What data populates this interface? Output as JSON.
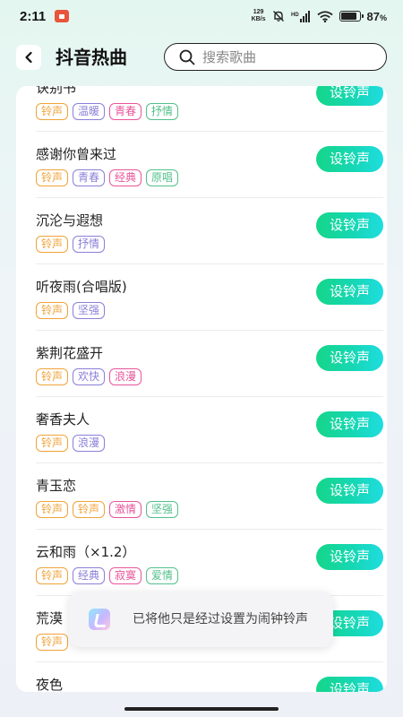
{
  "status_bar": {
    "time": "2:11",
    "net_speed_top": "129",
    "net_speed_bottom": "KB/s",
    "hd_label": "HD",
    "battery_percent": "87",
    "battery_suffix": "%",
    "battery_level": 0.87
  },
  "header": {
    "title": "抖音热曲",
    "search_placeholder": "搜索歌曲"
  },
  "tag_colors": {
    "铃声": "#f0a338",
    "温暖": "#8b7fd8",
    "青春": "#e8559a",
    "抒情": "#52c08a",
    "经典": "#e8559a",
    "原唱": "#52c08a",
    "坚强": "#8b7fd8",
    "欢快": "#8b7fd8",
    "浪漫": "#e8559a",
    "激情": "#e8559a",
    "寂寞": "#e8559a",
    "爱情": "#52c08a"
  },
  "set_button_label": "设铃声",
  "songs": [
    {
      "title": "诀别书",
      "tags": [
        {
          "label": "铃声",
          "color": "#f0a338"
        },
        {
          "label": "温暖",
          "color": "#8b7fd8"
        },
        {
          "label": "青春",
          "color": "#e8559a"
        },
        {
          "label": "抒情",
          "color": "#52c08a"
        }
      ]
    },
    {
      "title": "感谢你曾来过",
      "tags": [
        {
          "label": "铃声",
          "color": "#f0a338"
        },
        {
          "label": "青春",
          "color": "#8b7fd8"
        },
        {
          "label": "经典",
          "color": "#e8559a"
        },
        {
          "label": "原唱",
          "color": "#52c08a"
        }
      ]
    },
    {
      "title": "沉沦与遐想",
      "tags": [
        {
          "label": "铃声",
          "color": "#f0a338"
        },
        {
          "label": "抒情",
          "color": "#8b7fd8"
        }
      ]
    },
    {
      "title": "听夜雨(合唱版)",
      "tags": [
        {
          "label": "铃声",
          "color": "#f0a338"
        },
        {
          "label": "坚强",
          "color": "#8b7fd8"
        }
      ]
    },
    {
      "title": "紫荆花盛开",
      "tags": [
        {
          "label": "铃声",
          "color": "#f0a338"
        },
        {
          "label": "欢快",
          "color": "#8b7fd8"
        },
        {
          "label": "浪漫",
          "color": "#e8559a"
        }
      ]
    },
    {
      "title": "奢香夫人",
      "tags": [
        {
          "label": "铃声",
          "color": "#f0a338"
        },
        {
          "label": "浪漫",
          "color": "#8b7fd8"
        }
      ]
    },
    {
      "title": "青玉恋",
      "tags": [
        {
          "label": "铃声",
          "color": "#f0a338"
        },
        {
          "label": "铃声",
          "color": "#f0a338"
        },
        {
          "label": "激情",
          "color": "#e8559a"
        },
        {
          "label": "坚强",
          "color": "#52c08a"
        }
      ]
    },
    {
      "title": "云和雨（×1.2）",
      "tags": [
        {
          "label": "铃声",
          "color": "#f0a338"
        },
        {
          "label": "经典",
          "color": "#8b7fd8"
        },
        {
          "label": "寂寞",
          "color": "#e8559a"
        },
        {
          "label": "爱情",
          "color": "#52c08a"
        }
      ]
    },
    {
      "title": "荒漠",
      "tags": [
        {
          "label": "铃声",
          "color": "#f0a338"
        }
      ]
    },
    {
      "title": "夜色",
      "tags": []
    }
  ],
  "toast": {
    "message": "已将他只是经过设置为闹钟铃声"
  }
}
